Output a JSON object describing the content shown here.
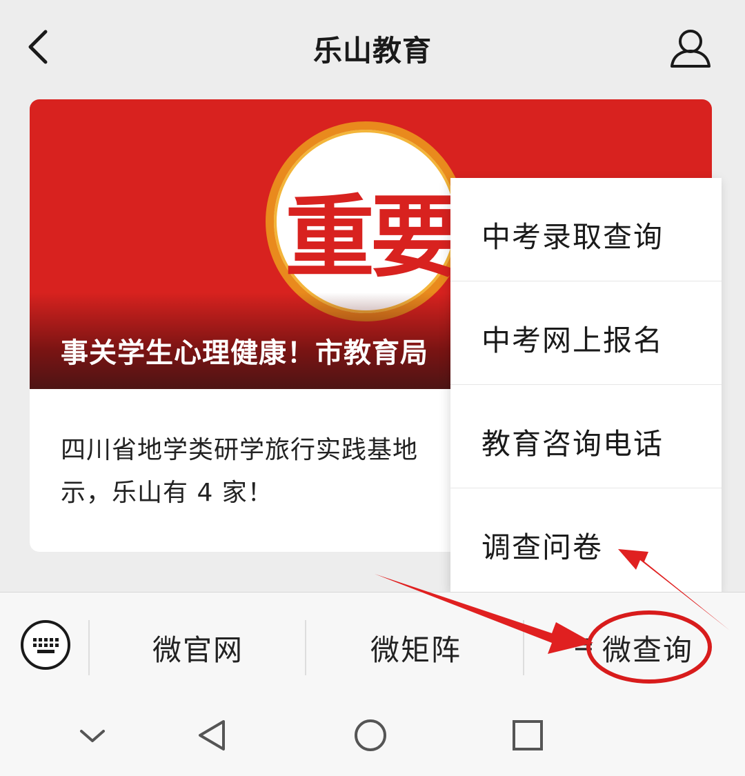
{
  "header": {
    "title": "乐山教育"
  },
  "card": {
    "badge_text": "重要",
    "banner_caption": "事关学生心理健康！市教育局",
    "body_line1": "四川省地学类研学旅行实践基地",
    "body_line2": "示，乐山有 4 家！"
  },
  "menu": {
    "items": [
      {
        "label": "中考录取查询"
      },
      {
        "label": "中考网上报名"
      },
      {
        "label": "教育咨询电话"
      },
      {
        "label": "调查问卷"
      }
    ]
  },
  "bottom_bar": {
    "tabs": [
      {
        "label": "微官网"
      },
      {
        "label": "微矩阵"
      },
      {
        "label": "微查询",
        "icon": "menu-lines-icon"
      }
    ]
  },
  "annotation": {
    "arrow_color": "#e02020",
    "circle_color": "#d81c1c"
  }
}
